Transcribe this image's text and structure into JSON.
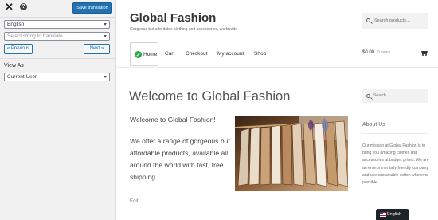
{
  "panel": {
    "close_glyph": "✕",
    "help_glyph": "?",
    "save_label": "Save translation",
    "language_value": "English",
    "string_placeholder": "Select string to translate...",
    "previous_label": "« Previous",
    "next_label": "Next »",
    "view_as_label": "View As",
    "view_as_value": "Current User"
  },
  "site": {
    "title": "Global Fashion",
    "tagline": "Gorgeous but affordable clothing and accessories, worldwide",
    "search_placeholder": "Search products…",
    "nav": [
      "Home",
      "Cart",
      "Checkout",
      "My account",
      "Shop"
    ],
    "cart_total": "$0.00",
    "cart_items": "0 items",
    "page_title": "Welcome to Global Fashion",
    "welcome_heading": "Welcome to Global Fashion!",
    "body": "We offer a range of gorgeous but affordable products, available all around the world with fast, free shipping.",
    "edit_label": "Edit",
    "side_search_placeholder": "Search …",
    "about_title": "About Us",
    "about_text": "Our mission at Global Fashion is to bring you amazing clothes and accessories at budget prices. We are an environmentally-friendly company and use sustainable cotton wherever possible.",
    "language_switcher": "English"
  },
  "colors": {
    "accent": "#2271b1",
    "home_icon": "#2ba84a",
    "admin_bar": "#1d2327"
  },
  "icons": {
    "close": "close-icon",
    "help": "help-icon",
    "search": "search-icon",
    "cart": "cart-basket-icon",
    "home": "home-icon",
    "flag": "uk-flag-icon"
  }
}
